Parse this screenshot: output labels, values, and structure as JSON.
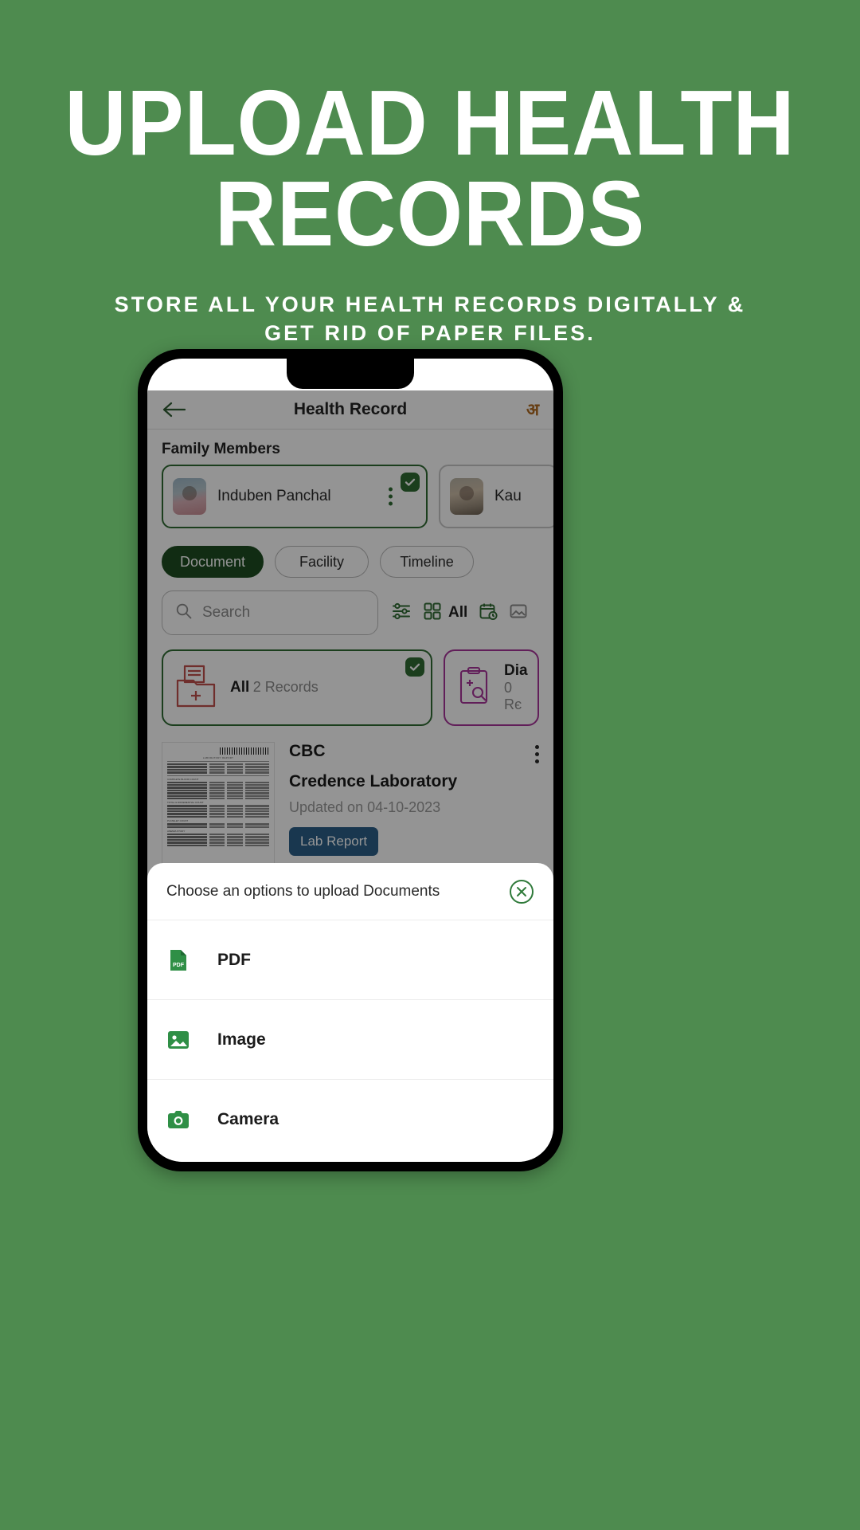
{
  "promo": {
    "title_line1": "Upload Health",
    "title_line2": "Records",
    "subtitle_line1": "Store all your health records digitally &",
    "subtitle_line2": "get rid of paper files.",
    "background_color": "#4e8b4f",
    "text_color": "#ffffff"
  },
  "app": {
    "appbar": {
      "title": "Health Record",
      "back_icon": "arrow-left-icon",
      "right_text": "अ"
    },
    "family": {
      "section_title": "Family Members",
      "members": [
        {
          "name": "Induben Panchal",
          "selected": true
        },
        {
          "name": "Kau",
          "selected": false
        }
      ]
    },
    "tabs": [
      {
        "label": "Document",
        "active": true
      },
      {
        "label": "Facility",
        "active": false
      },
      {
        "label": "Timeline",
        "active": false
      }
    ],
    "search": {
      "placeholder": "Search",
      "value": "",
      "icon": "search-icon"
    },
    "toolbar_icons": [
      {
        "name": "filter-sliders-icon"
      },
      {
        "name": "grid-view-icon"
      },
      {
        "name": "all-label",
        "label": "All"
      },
      {
        "name": "calendar-clock-icon"
      },
      {
        "name": "hide-image-icon"
      }
    ],
    "categories": [
      {
        "title": "All",
        "subtitle": "2 Records",
        "selected": true,
        "accent": "#2f6b33"
      },
      {
        "title": "Dia",
        "subtitle": "0 Rє",
        "selected": false,
        "accent": "#a8359a"
      }
    ],
    "document": {
      "title": "CBC",
      "lab": "Credence Laboratory",
      "updated": "Updated on 04-10-2023",
      "chip": "Lab Report",
      "chip_color": "#2b6089",
      "menu_icon": "kebab-menu-icon",
      "thumbnail_header": "LABORATORY REPORT",
      "thumbnail_section1": "COMPLETE BLOOD COUNT",
      "thumbnail_section2": "TOTAL & DIFFERENTIAL COUNT",
      "thumbnail_section3": "PLATELET COUNT",
      "thumbnail_section4": "ANEMIA STUDY"
    }
  },
  "sheet": {
    "title": "Choose an options to upload Documents",
    "close_icon": "close-circle-icon",
    "options": [
      {
        "label": "PDF",
        "icon": "pdf-file-icon"
      },
      {
        "label": "Image",
        "icon": "image-icon"
      },
      {
        "label": "Camera",
        "icon": "camera-icon"
      }
    ]
  }
}
